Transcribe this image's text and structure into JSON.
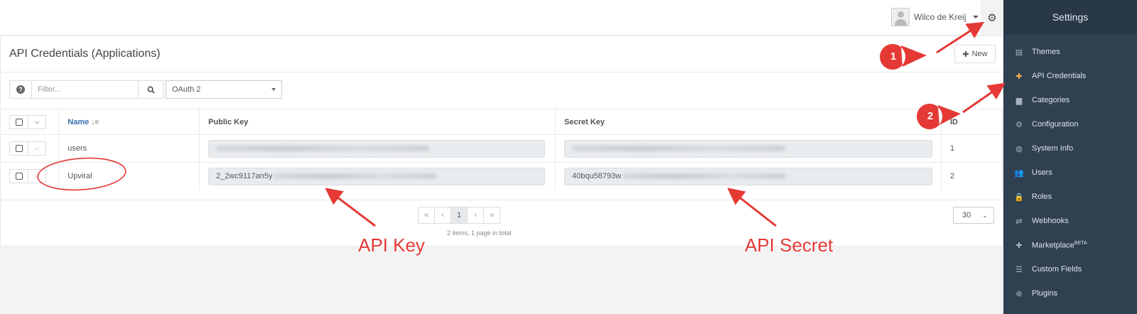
{
  "topbar": {
    "user_name": "Wilco de Kreij"
  },
  "page": {
    "title": "API Credentials (Applications)",
    "new_label": "New"
  },
  "toolbar": {
    "filter_placeholder": "Filter...",
    "oauth_select": "OAuth 2"
  },
  "table": {
    "headers": {
      "name": "Name",
      "public_key": "Public Key",
      "secret_key": "Secret Key",
      "id": "ID"
    },
    "rows": [
      {
        "name": "users",
        "public_key_visible": "",
        "secret_key_visible": "",
        "id": "1"
      },
      {
        "name": "Upviral",
        "public_key_visible": "2_2wc9117an5y",
        "secret_key_visible": "40bqu58793w",
        "id": "2"
      }
    ]
  },
  "pagination": {
    "first": "«",
    "prev": "‹",
    "page": "1",
    "next": "›",
    "last": "»",
    "info": "2 items, 1 page in total",
    "per_page": "30"
  },
  "sidebar": {
    "title": "Settings",
    "items": [
      {
        "label": "Themes",
        "icon": "themes-icon",
        "glyph": "▤"
      },
      {
        "label": "API Credentials",
        "icon": "puzzle-icon",
        "glyph": "✚",
        "active": true
      },
      {
        "label": "Categories",
        "icon": "folder-icon",
        "glyph": "▆"
      },
      {
        "label": "Configuration",
        "icon": "cogs-icon",
        "glyph": "⚙"
      },
      {
        "label": "System Info",
        "icon": "globe-icon",
        "glyph": "◍"
      },
      {
        "label": "Users",
        "icon": "users-icon",
        "glyph": "👥"
      },
      {
        "label": "Roles",
        "icon": "lock-icon",
        "glyph": "🔒"
      },
      {
        "label": "Webhooks",
        "icon": "exchange-icon",
        "glyph": "⇄"
      },
      {
        "label": "Marketplace",
        "sup": "BETA",
        "icon": "plus-icon",
        "glyph": "✚"
      },
      {
        "label": "Custom Fields",
        "icon": "list-icon",
        "glyph": "☰"
      },
      {
        "label": "Plugins",
        "icon": "plus-circle-icon",
        "glyph": "⊕"
      }
    ]
  },
  "annotations": {
    "label_api_key": "API Key",
    "label_api_secret": "API Secret",
    "badge_1": "1",
    "badge_2": "2",
    "color": "#e53935"
  }
}
